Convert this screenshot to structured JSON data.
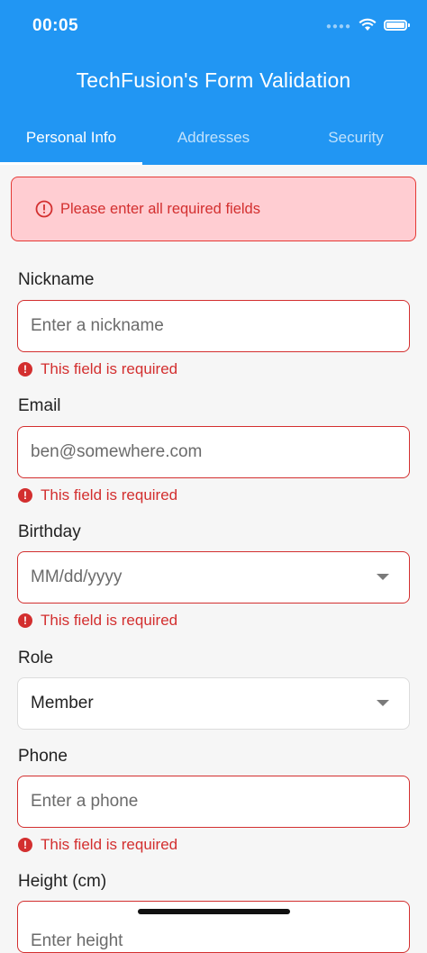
{
  "status_bar": {
    "time": "00:05"
  },
  "app_bar": {
    "title": "TechFusion's Form Validation"
  },
  "tabs": [
    {
      "label": "Personal Info",
      "active": true
    },
    {
      "label": "Addresses",
      "active": false
    },
    {
      "label": "Security",
      "active": false
    }
  ],
  "banner": {
    "message": "Please enter all required fields"
  },
  "fields": {
    "nickname": {
      "label": "Nickname",
      "placeholder": "Enter a nickname",
      "error": "This field is required"
    },
    "email": {
      "label": "Email",
      "placeholder": "ben@somewhere.com",
      "error": "This field is required"
    },
    "birthday": {
      "label": "Birthday",
      "placeholder": "MM/dd/yyyy",
      "error": "This field is required"
    },
    "role": {
      "label": "Role",
      "value": "Member"
    },
    "phone": {
      "label": "Phone",
      "placeholder": "Enter a phone",
      "error": "This field is required"
    },
    "height": {
      "label": "Height (cm)",
      "placeholder": "Enter height"
    }
  },
  "colors": {
    "primary": "#2196f3",
    "error": "#d32f2f",
    "error_bg": "#ffcdd2"
  }
}
